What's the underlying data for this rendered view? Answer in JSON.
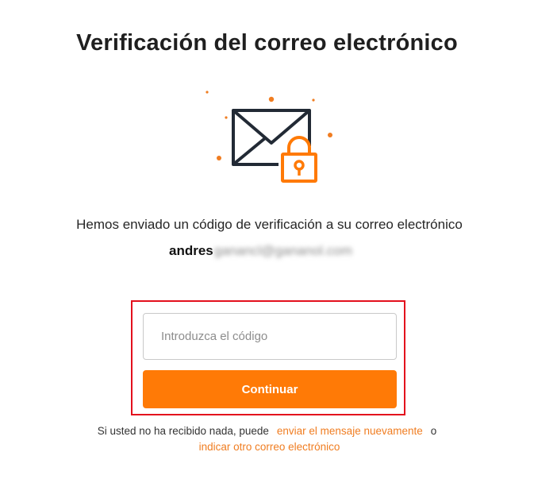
{
  "page": {
    "title": "Verificación del correo electrónico"
  },
  "illustration": {
    "icon": "email-lock-icon",
    "colors": {
      "envelope": "#222a35",
      "lock": "#ff7a06",
      "dots": "#f07d21"
    }
  },
  "message": {
    "sent_text": "Hemos enviado un código de verificación a su correo electrónico",
    "email_visible": "andres",
    "email_redacted": "ganancl@gananol.com"
  },
  "form": {
    "code_placeholder": "Introduzca el código",
    "code_value": "",
    "continue_label": "Continuar"
  },
  "footer": {
    "prefix": "Si usted no ha recibido nada, puede",
    "resend_link": "enviar el mensaje nuevamente",
    "conjunction": "o",
    "change_email_link": "indicar otro correo electrónico"
  },
  "colors": {
    "accent": "#ff7a06",
    "link": "#f07d21",
    "highlight_border": "#e3101d",
    "title": "#1f1f1f"
  }
}
